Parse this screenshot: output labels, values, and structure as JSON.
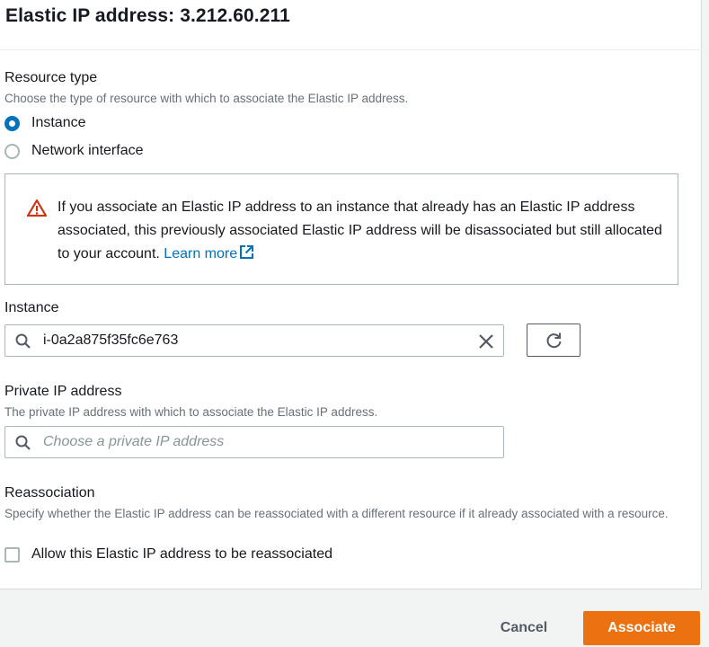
{
  "header": {
    "title": "Elastic IP address: 3.212.60.211"
  },
  "resource_type": {
    "label": "Resource type",
    "description": "Choose the type of resource with which to associate the Elastic IP address.",
    "options": [
      {
        "label": "Instance",
        "selected": true
      },
      {
        "label": "Network interface",
        "selected": false
      }
    ]
  },
  "alert": {
    "icon": "warning-triangle-icon",
    "text": "If you associate an Elastic IP address to an instance that already has an Elastic IP address associated, this previously associated Elastic IP address will be disassociated but still allocated to your account. ",
    "link_label": "Learn more",
    "link_icon": "external-link-icon"
  },
  "instance": {
    "label": "Instance",
    "value": "i-0a2a875f35fc6e763"
  },
  "private_ip": {
    "label": "Private IP address",
    "description": "The private IP address with which to associate the Elastic IP address.",
    "placeholder": "Choose a private IP address"
  },
  "reassociation": {
    "label": "Reassociation",
    "description": "Specify whether the Elastic IP address can be reassociated with a different resource if it already associated with a resource.",
    "checkbox_label": "Allow this Elastic IP address to be reassociated",
    "checked": false
  },
  "footer": {
    "cancel_label": "Cancel",
    "associate_label": "Associate"
  },
  "colors": {
    "primary_button": "#ec7211",
    "link": "#0073bb",
    "warning": "#d13212",
    "radio_selected": "#0073bb"
  }
}
